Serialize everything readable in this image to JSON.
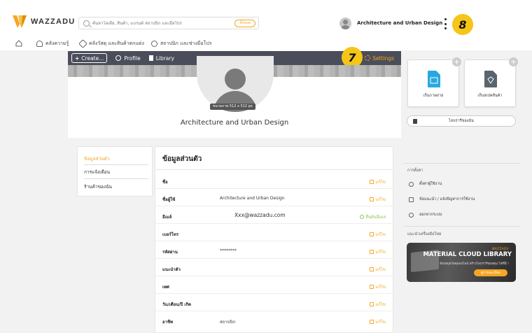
{
  "header": {
    "logo_text": "WAZZADU",
    "search_placeholder": "ค้นหาไอเดีย, สินค้า, แบรนด์ สถาปนิก และมือโปร",
    "search_scope": "ทั้งหมด",
    "user_name": "Architecture and Urban Design",
    "badge_8": "8",
    "badge_7": "7"
  },
  "nav": {
    "items": [
      {
        "label": "คลังความรู้",
        "icon": "bulb-icon"
      },
      {
        "label": "คลังวัสดุ และสินค้าตกแต่ง",
        "icon": "tag-icon"
      },
      {
        "label": "สถาปนิก และช่างมือโปร",
        "icon": "helmet-icon"
      }
    ]
  },
  "toolbar": {
    "create": "Create...",
    "profile": "Profile",
    "library": "Library",
    "settings": "Settings"
  },
  "profile": {
    "size_tag": "ขนาดภาพ 512 x 512 px",
    "name": "Architecture and Urban Design"
  },
  "right_widgets": {
    "upload_photo": "เก็บภาพถ่าย",
    "upload_product": "เก็บสเปคสินค้า",
    "my_library": "ไลบรารีของฉัน"
  },
  "side_menu": {
    "items": [
      "ข้อมูลส่วนตัว",
      "การแจ้งเตือน",
      "ร้านค้าของฉัน"
    ]
  },
  "info": {
    "title": "ข้อมูลส่วนตัว",
    "edit_label": "แก้ไข",
    "verify_label": "ยืนยันอีเมล",
    "rows": [
      {
        "label": "ชื่อ",
        "value": ""
      },
      {
        "label": "ชื่อผู้ใช้",
        "value": "Architecture and Urban Design"
      },
      {
        "label": "อีเมล์",
        "value": "Xxx@wazzadu.com"
      },
      {
        "label": "เบอร์โทร",
        "value": ""
      },
      {
        "label": "รหัสผ่าน",
        "value": "********"
      },
      {
        "label": "แนะนำตัว",
        "value": ""
      },
      {
        "label": "เพศ",
        "value": ""
      },
      {
        "label": "วัน/เดือน/ปี เกิด",
        "value": ""
      },
      {
        "label": "อาชีพ",
        "value": "สถาปนิก"
      }
    ]
  },
  "settings": {
    "heading": "การตั้งค่า",
    "items": [
      "ตั้งค่าผู้ใช้งาน",
      "ข้อแนะนำ / แจ้งปัญหาการใช้งาน",
      "ออกจากระบบ"
    ],
    "recommend_heading": "แนะนำเครื่องมือใหม่"
  },
  "promo": {
    "brand": "WAZZADU",
    "title": "MATERIAL CLOUD LIBRARY",
    "subtitle": "ห้องสมุดวัสดุออนไลน์ สร้างไลบรารีของคุณ ได้ที่นี่ !",
    "button": "ดูรายละเอียด"
  },
  "colors": {
    "accent": "#f5a623",
    "toolbar": "#4a4d5a",
    "verified": "#8bc34a",
    "badge": "#f5c518"
  }
}
